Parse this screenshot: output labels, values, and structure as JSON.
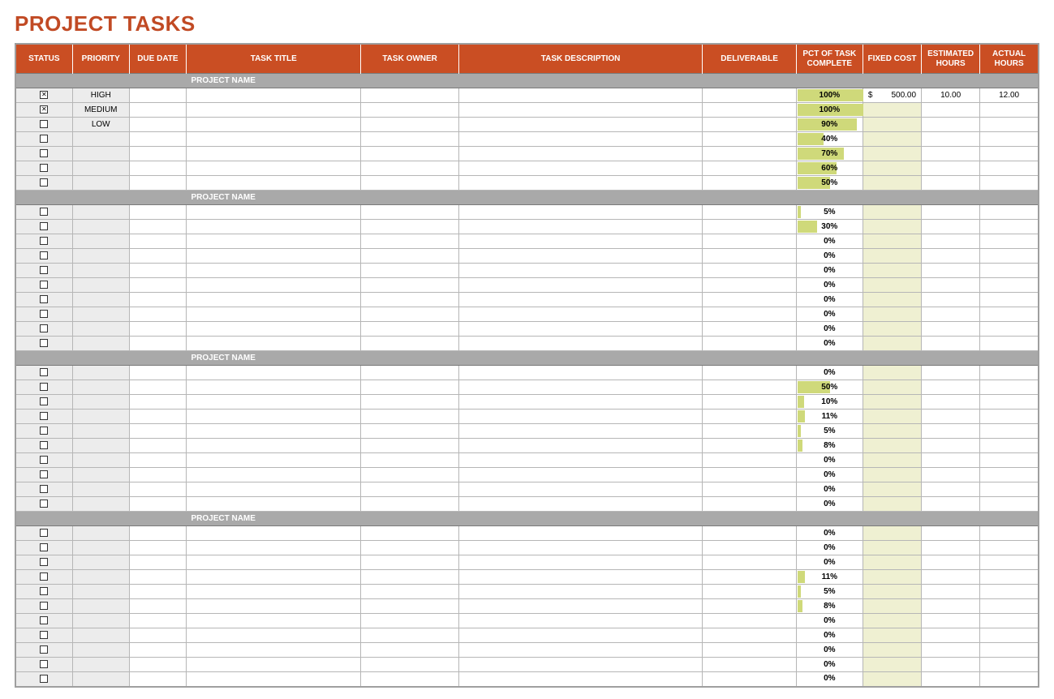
{
  "title": "PROJECT TASKS",
  "columns": [
    "STATUS",
    "PRIORITY",
    "DUE DATE",
    "TASK TITLE",
    "TASK OWNER",
    "TASK DESCRIPTION",
    "DELIVERABLE",
    "PCT OF TASK COMPLETE",
    "FIXED COST",
    "ESTIMATED HOURS",
    "ACTUAL HOURS"
  ],
  "section_label": "PROJECT NAME",
  "sections": [
    {
      "rows": [
        {
          "checked": true,
          "priority": "HIGH",
          "pct": 100,
          "fixed_cost": "500.00",
          "est": "10.00",
          "act": "12.00"
        },
        {
          "checked": true,
          "priority": "MEDIUM",
          "pct": 100
        },
        {
          "checked": false,
          "priority": "LOW",
          "pct": 90
        },
        {
          "checked": false,
          "pct": 40
        },
        {
          "checked": false,
          "pct": 70
        },
        {
          "checked": false,
          "pct": 60
        },
        {
          "checked": false,
          "pct": 50
        }
      ]
    },
    {
      "rows": [
        {
          "checked": false,
          "pct": 5
        },
        {
          "checked": false,
          "pct": 30
        },
        {
          "checked": false,
          "pct": 0
        },
        {
          "checked": false,
          "pct": 0
        },
        {
          "checked": false,
          "pct": 0
        },
        {
          "checked": false,
          "pct": 0
        },
        {
          "checked": false,
          "pct": 0
        },
        {
          "checked": false,
          "pct": 0
        },
        {
          "checked": false,
          "pct": 0
        },
        {
          "checked": false,
          "pct": 0
        }
      ]
    },
    {
      "rows": [
        {
          "checked": false,
          "pct": 0
        },
        {
          "checked": false,
          "pct": 50
        },
        {
          "checked": false,
          "pct": 10
        },
        {
          "checked": false,
          "pct": 11
        },
        {
          "checked": false,
          "pct": 5
        },
        {
          "checked": false,
          "pct": 8
        },
        {
          "checked": false,
          "pct": 0
        },
        {
          "checked": false,
          "pct": 0
        },
        {
          "checked": false,
          "pct": 0
        },
        {
          "checked": false,
          "pct": 0
        }
      ]
    },
    {
      "rows": [
        {
          "checked": false,
          "pct": 0
        },
        {
          "checked": false,
          "pct": 0
        },
        {
          "checked": false,
          "pct": 0
        },
        {
          "checked": false,
          "pct": 11
        },
        {
          "checked": false,
          "pct": 5
        },
        {
          "checked": false,
          "pct": 8
        },
        {
          "checked": false,
          "pct": 0
        },
        {
          "checked": false,
          "pct": 0
        },
        {
          "checked": false,
          "pct": 0
        },
        {
          "checked": false,
          "pct": 0
        },
        {
          "checked": false,
          "pct": 0
        }
      ]
    }
  ]
}
